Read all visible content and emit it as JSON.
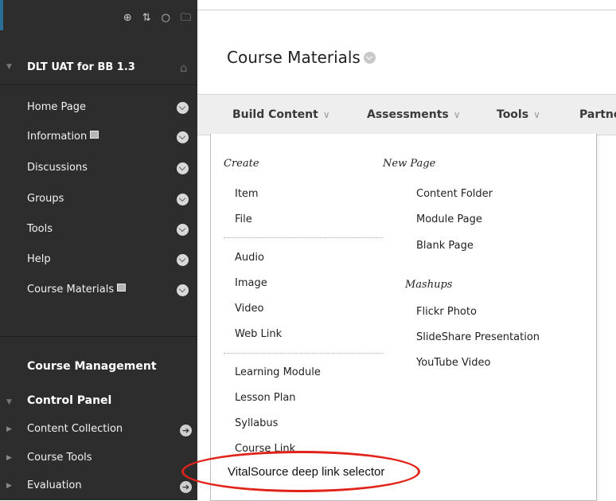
{
  "sidebar": {
    "course_title": "DLT UAT for BB 1.3",
    "nav_items": [
      {
        "label": "Home Page",
        "badge": false
      },
      {
        "label": "Information",
        "badge": true
      },
      {
        "label": "Discussions",
        "badge": false
      },
      {
        "label": "Groups",
        "badge": false
      },
      {
        "label": "Tools",
        "badge": false
      },
      {
        "label": "Help",
        "badge": false
      },
      {
        "label": "Course Materials",
        "badge": true
      }
    ],
    "course_management_label": "Course Management",
    "control_panel_label": "Control Panel",
    "control_panel_items": [
      {
        "label": "Content Collection",
        "has_arrow": true
      },
      {
        "label": "Course Tools",
        "has_arrow": false
      },
      {
        "label": "Evaluation",
        "has_arrow": true
      }
    ],
    "accent_color": "#2a6f9a",
    "icons": [
      "plus-circle-icon",
      "sort-icon",
      "refresh-icon",
      "folder-icon",
      "home-icon"
    ]
  },
  "main": {
    "page_title": "Course Materials",
    "action_bar": [
      {
        "label": "Build Content"
      },
      {
        "label": "Assessments"
      },
      {
        "label": "Tools"
      },
      {
        "label": "Partne"
      }
    ],
    "build_content_menu": {
      "create_header": "Create",
      "create_group1": [
        "Item",
        "File"
      ],
      "create_group2": [
        "Audio",
        "Image",
        "Video",
        "Web Link"
      ],
      "create_group3": [
        "Learning Module",
        "Lesson Plan",
        "Syllabus",
        "Course Link"
      ],
      "highlighted_item": "VitalSource deep link selector",
      "new_page_header": "New Page",
      "new_page_items": [
        "Content Folder",
        "Module Page",
        "Blank Page"
      ],
      "mashups_header": "Mashups",
      "mashups_items": [
        "Flickr Photo",
        "SlideShare Presentation",
        "YouTube Video"
      ]
    },
    "highlight_color": "#e2231a"
  }
}
